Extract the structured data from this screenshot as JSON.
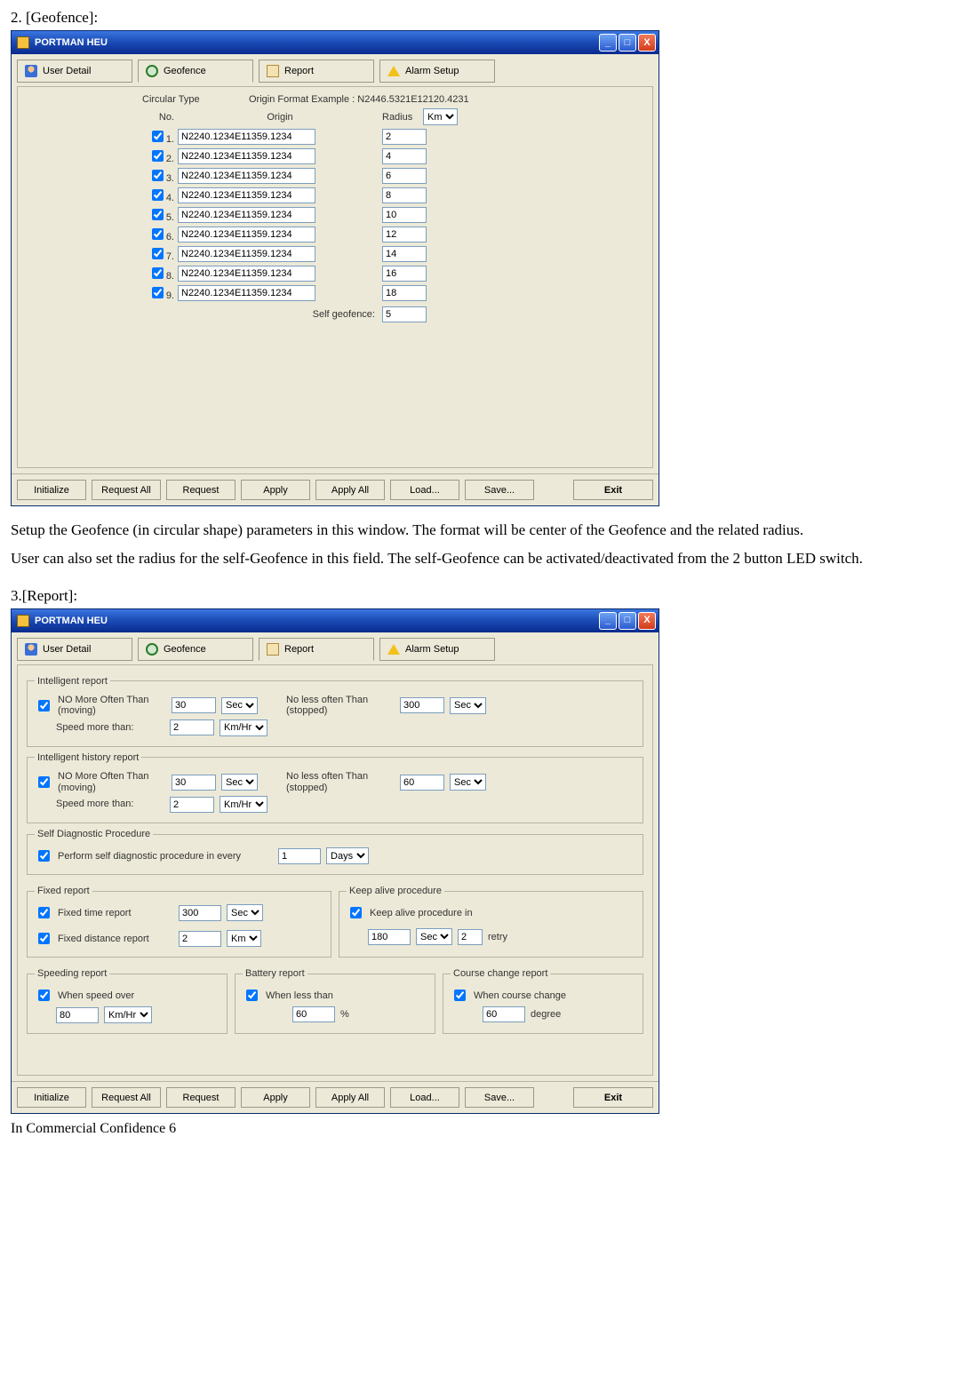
{
  "doc": {
    "heading1": "2. [Geofence]:",
    "para1": "Setup the Geofence (in circular shape) parameters in this window. The format will be center of the Geofence and the related radius.",
    "para2": "User can also set the radius for the self-Geofence in this field. The self-Geofence can be activated/deactivated from the 2 button LED switch.",
    "heading2": "3.[Report]:",
    "footer_left": "In Commercial Confidence",
    "footer_page": "6"
  },
  "app": {
    "title": "PORTMAN HEU",
    "tabs": {
      "user": "User Detail",
      "geo": "Geofence",
      "report": "Report",
      "alarm": "Alarm Setup"
    },
    "buttons": {
      "init": "Initialize",
      "reqall": "Request All",
      "req": "Request",
      "apply": "Apply",
      "applyall": "Apply All",
      "load": "Load...",
      "save": "Save...",
      "exit": "Exit"
    },
    "winctl": {
      "min": "_",
      "max": "□",
      "close": "X"
    }
  },
  "geofence": {
    "type_label": "Circular Type",
    "format_label": "Origin Format   Example : N2446.5321E12120.4231",
    "col_no": "No.",
    "col_origin": "Origin",
    "col_radius": "Radius",
    "unit_options": [
      "Km"
    ],
    "rows": [
      {
        "n": "1.",
        "origin": "N2240.1234E11359.1234",
        "radius": "2"
      },
      {
        "n": "2.",
        "origin": "N2240.1234E11359.1234",
        "radius": "4"
      },
      {
        "n": "3.",
        "origin": "N2240.1234E11359.1234",
        "radius": "6"
      },
      {
        "n": "4.",
        "origin": "N2240.1234E11359.1234",
        "radius": "8"
      },
      {
        "n": "5.",
        "origin": "N2240.1234E11359.1234",
        "radius": "10"
      },
      {
        "n": "6.",
        "origin": "N2240.1234E11359.1234",
        "radius": "12"
      },
      {
        "n": "7.",
        "origin": "N2240.1234E11359.1234",
        "radius": "14"
      },
      {
        "n": "8.",
        "origin": "N2240.1234E11359.1234",
        "radius": "16"
      },
      {
        "n": "9.",
        "origin": "N2240.1234E11359.1234",
        "radius": "18"
      }
    ],
    "self_label": "Self geofence:",
    "self_value": "5"
  },
  "report": {
    "grp_intel": "Intelligent report",
    "grp_intel_hist": "Intelligent history report",
    "grp_selfdiag": "Self Diagnostic Procedure",
    "grp_fixed": "Fixed report",
    "grp_keepalive": "Keep alive procedure",
    "grp_speeding": "Speeding report",
    "grp_battery": "Battery report",
    "grp_course": "Course change report",
    "lbl_nomore": "NO More Often Than (moving)",
    "lbl_noless": "No less often Than (stopped)",
    "lbl_speedmore": "Speed more than:",
    "lbl_selfdiag": "Perform self diagnostic procedure in every",
    "lbl_fixed_time": "Fixed time report",
    "lbl_fixed_dist": "Fixed distance report",
    "lbl_keepalive": "Keep alive procedure in",
    "lbl_retry": "retry",
    "lbl_speedover": "When speed over",
    "lbl_lessthan": "When less than",
    "lbl_pct": "%",
    "lbl_course": "When course change",
    "lbl_degree": "degree",
    "intel": {
      "nomore": "30",
      "nomore_u": "Sec",
      "noless": "300",
      "noless_u": "Sec",
      "speed": "2",
      "speed_u": "Km/Hr"
    },
    "intel_hist": {
      "nomore": "30",
      "nomore_u": "Sec",
      "noless": "60",
      "noless_u": "Sec",
      "speed": "2",
      "speed_u": "Km/Hr"
    },
    "selfdiag": {
      "val": "1",
      "unit": "Days"
    },
    "fixed": {
      "time": "300",
      "time_u": "Sec",
      "dist": "2",
      "dist_u": "Km"
    },
    "keepalive": {
      "val": "180",
      "unit": "Sec",
      "retry": "2"
    },
    "speeding": {
      "val": "80",
      "unit": "Km/Hr"
    },
    "battery": {
      "val": "60"
    },
    "course": {
      "val": "60"
    },
    "unit_sec": [
      "Sec"
    ],
    "unit_kmhr": [
      "Km/Hr"
    ],
    "unit_days": [
      "Days"
    ],
    "unit_km": [
      "Km"
    ]
  }
}
